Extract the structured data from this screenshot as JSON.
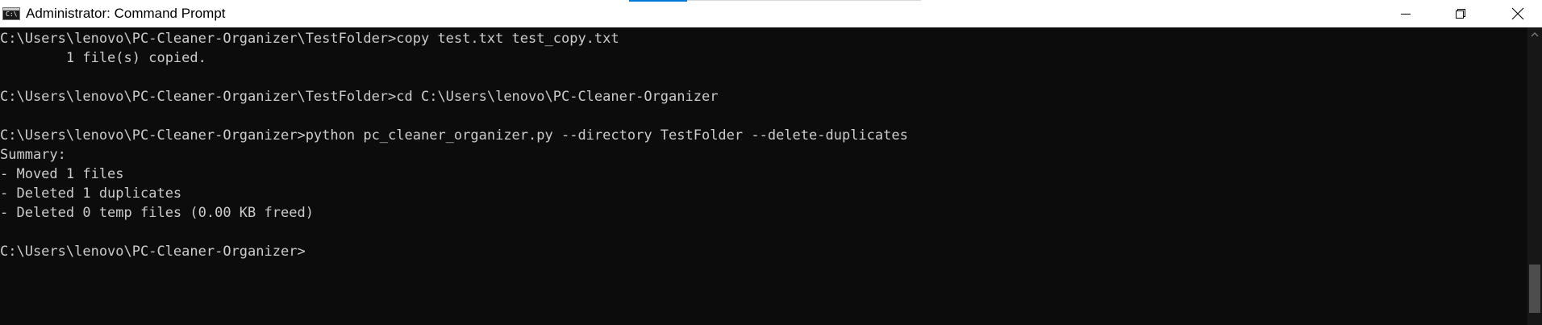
{
  "window": {
    "title": "Administrator: Command Prompt",
    "icon_name": "cmd-app-icon",
    "icon_glyph": "C:\\",
    "controls": {
      "minimize_icon": "minimize-icon",
      "maximize_icon": "restore-icon",
      "close_icon": "close-icon"
    }
  },
  "console": {
    "background": "#0c0c0c",
    "foreground": "#cccccc",
    "lines": [
      "C:\\Users\\lenovo\\PC-Cleaner-Organizer\\TestFolder>copy test.txt test_copy.txt",
      "        1 file(s) copied.",
      "",
      "C:\\Users\\lenovo\\PC-Cleaner-Organizer\\TestFolder>cd C:\\Users\\lenovo\\PC-Cleaner-Organizer",
      "",
      "C:\\Users\\lenovo\\PC-Cleaner-Organizer>python pc_cleaner_organizer.py --directory TestFolder --delete-duplicates",
      "Summary:",
      "- Moved 1 files",
      "- Deleted 1 duplicates",
      "- Deleted 0 temp files (0.00 KB freed)",
      "",
      "C:\\Users\\lenovo\\PC-Cleaner-Organizer>"
    ]
  },
  "scrollbar": {
    "up_arrow_icon": "scroll-up-arrow-icon",
    "position_fraction": 0.95
  }
}
